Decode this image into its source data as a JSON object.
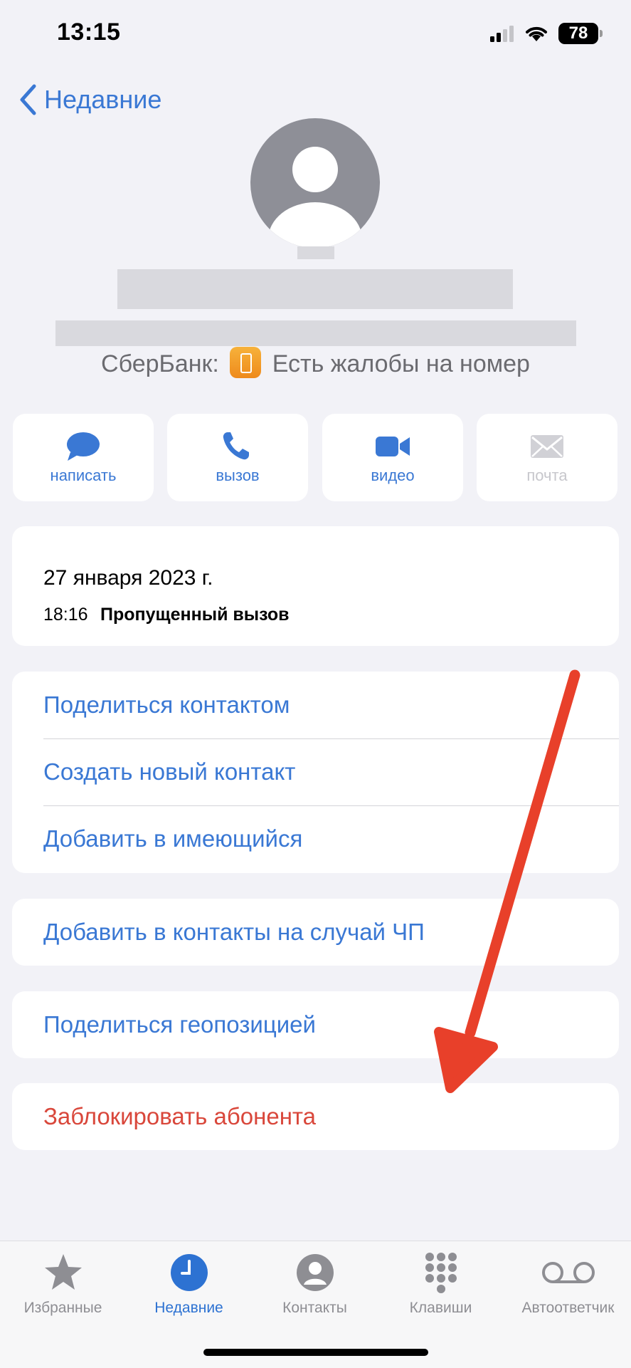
{
  "status_bar": {
    "time": "13:15",
    "battery": "78"
  },
  "nav": {
    "back_label": "Недавние"
  },
  "contact": {
    "caller_tag_prefix": "СберБанк:",
    "caller_tag_text": "Есть жалобы на номер"
  },
  "actions": [
    {
      "label": "написать",
      "icon": "message-icon",
      "enabled": true
    },
    {
      "label": "вызов",
      "icon": "phone-icon",
      "enabled": true
    },
    {
      "label": "видео",
      "icon": "video-icon",
      "enabled": true
    },
    {
      "label": "почта",
      "icon": "mail-icon",
      "enabled": false
    }
  ],
  "call_log": {
    "date": "27 января 2023 г.",
    "time": "18:16",
    "type": "Пропущенный вызов"
  },
  "options_group1": [
    "Поделиться контактом",
    "Создать новый контакт",
    "Добавить в имеющийся"
  ],
  "options": {
    "emergency": "Добавить в контакты на случай ЧП",
    "share_location": "Поделиться геопозицией",
    "block": "Заблокировать абонента"
  },
  "tabs": [
    {
      "label": "Избранные",
      "icon": "star-icon",
      "active": false
    },
    {
      "label": "Недавние",
      "icon": "clock-icon",
      "active": true
    },
    {
      "label": "Контакты",
      "icon": "person-icon",
      "active": false
    },
    {
      "label": "Клавиши",
      "icon": "keypad-icon",
      "active": false
    },
    {
      "label": "Автоответчик",
      "icon": "voicemail-icon",
      "active": false
    }
  ],
  "colors": {
    "accent": "#3a78d4",
    "danger": "#d9473b",
    "arrow": "#e8402a",
    "background": "#f2f2f7"
  }
}
